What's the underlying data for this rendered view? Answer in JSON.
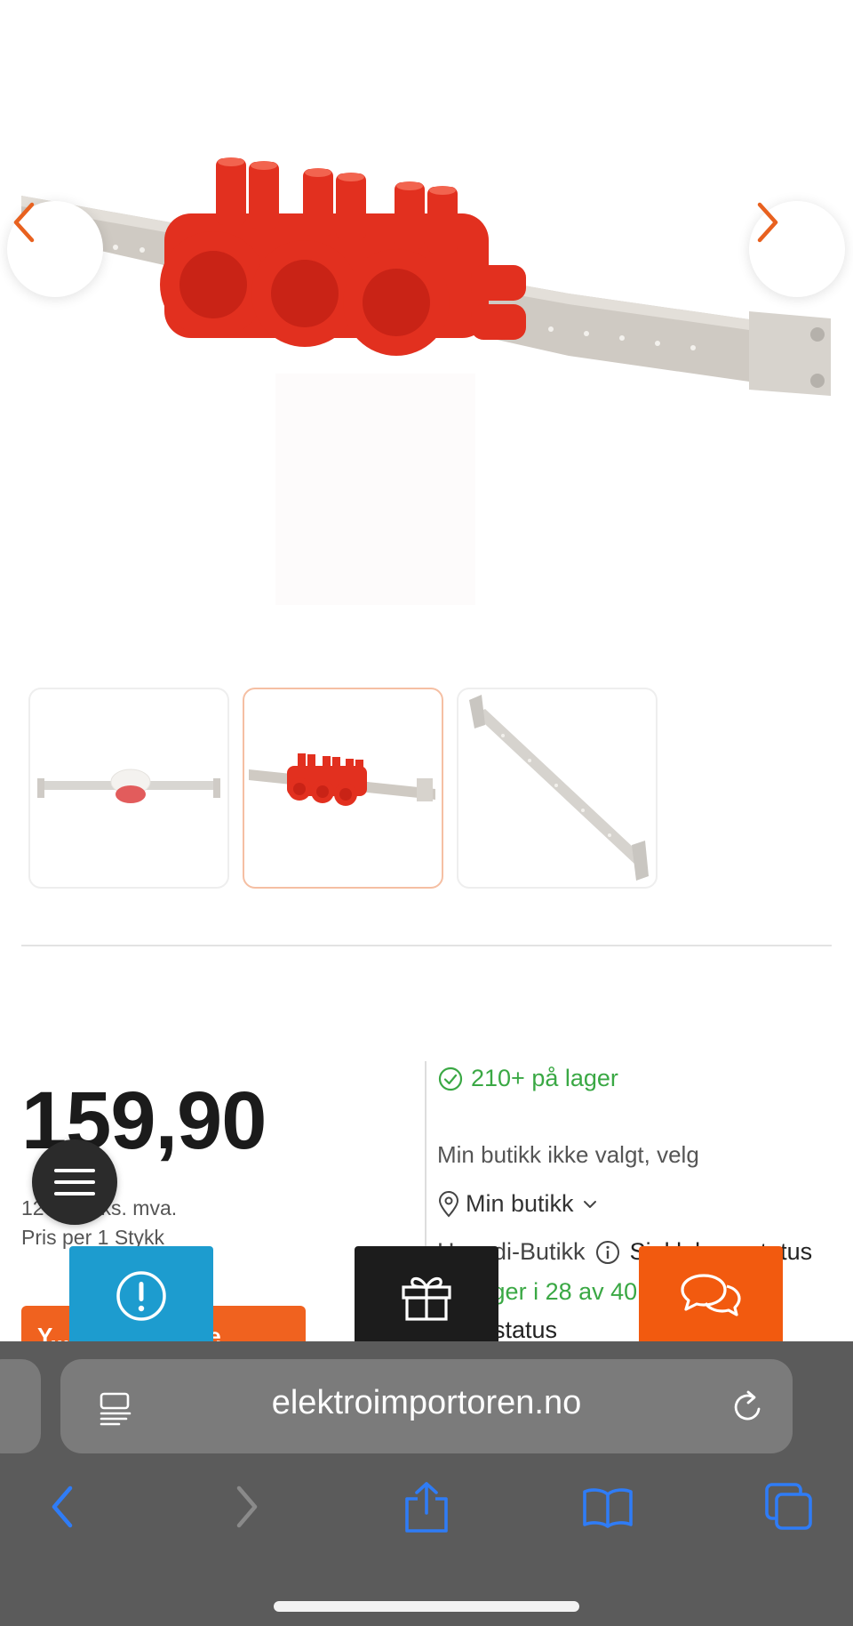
{
  "product": {
    "price": "159,90",
    "price_ex_vat": "127,92 eks. mva.",
    "price_per": "Pris per 1 Stykk",
    "cart_button": "Y...i handlekasse"
  },
  "stock": {
    "in_stock": "210+ på lager",
    "store_not_selected": "Min butikk ikke valgt, velg",
    "my_store": "Min butikk",
    "hovedi_label": "Hovedi-Butikk",
    "check_status": "Sjekk lagerstatus",
    "stores_line": "På lager i 28 av 40 butikkse",
    "status_word": "status"
  },
  "browser": {
    "url": "elektroimportoren.no"
  },
  "colors": {
    "accent": "#f0621f",
    "stock_green": "#3aa844",
    "info_blue": "#1d9ccf",
    "ios_blue": "#2f7cf6"
  },
  "icons": {
    "prev": "chevron-left-icon",
    "next": "chevron-right-icon",
    "stock": "check-circle-icon",
    "location": "location-pin-icon",
    "info": "info-icon",
    "menu": "hamburger-icon",
    "alert": "exclamation-circle-icon",
    "gift": "gift-icon",
    "chat": "chat-bubbles-icon",
    "reader": "reader-icon",
    "reload": "reload-icon",
    "back": "back-icon",
    "forward": "forward-icon",
    "share": "share-icon",
    "bookmarks": "bookmarks-icon",
    "tabs": "tabs-icon"
  }
}
